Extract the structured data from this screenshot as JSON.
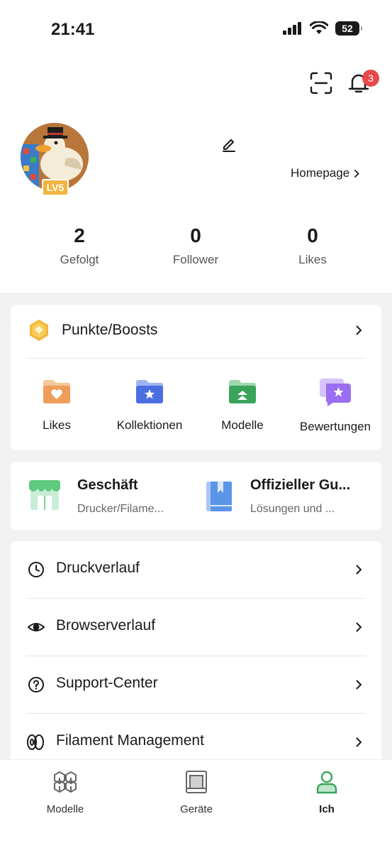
{
  "status_bar": {
    "time": "21:41",
    "battery": "52"
  },
  "header": {
    "notification_count": "3"
  },
  "profile": {
    "level": "LV5",
    "homepage_label": "Homepage"
  },
  "stats": [
    {
      "value": "2",
      "label": "Gefolgt"
    },
    {
      "value": "0",
      "label": "Follower"
    },
    {
      "value": "0",
      "label": "Likes"
    }
  ],
  "points": {
    "title": "Punkte/Boosts"
  },
  "shortcuts": [
    {
      "label": "Likes",
      "icon": "heart-folder-icon"
    },
    {
      "label": "Kollektionen",
      "icon": "star-folder-icon"
    },
    {
      "label": "Modelle",
      "icon": "upload-folder-icon"
    },
    {
      "label": "Bewertungen",
      "icon": "review-chat-icon"
    }
  ],
  "shop": {
    "store_title": "Geschäft",
    "store_sub": "Drucker/Filame...",
    "guide_title": "Offizieller Gu...",
    "guide_sub": "Lösungen und ..."
  },
  "menu": [
    {
      "label": "Druckverlauf",
      "icon": "clock-icon"
    },
    {
      "label": "Browserverlauf",
      "icon": "eye-icon"
    },
    {
      "label": "Support-Center",
      "icon": "question-icon"
    },
    {
      "label": "Filament Management",
      "icon": "filament-icon"
    }
  ],
  "tabs": [
    {
      "label": "Modelle",
      "active": false
    },
    {
      "label": "Geräte",
      "active": false
    },
    {
      "label": "Ich",
      "active": true
    }
  ],
  "colors": {
    "accent_green": "#3aa35c",
    "badge_red": "#e64a4a",
    "gold": "#f0b540"
  }
}
